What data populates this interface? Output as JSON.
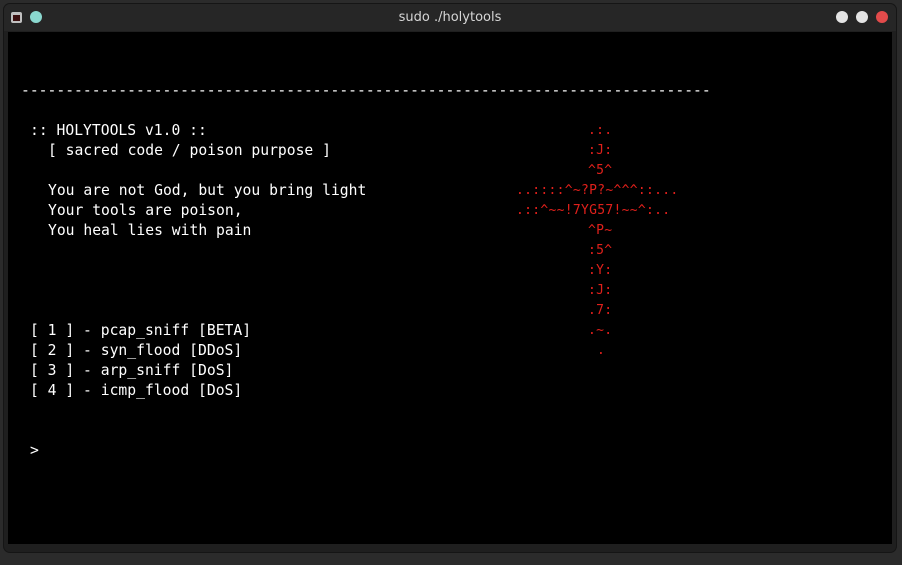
{
  "window": {
    "title": "sudo ./holytools"
  },
  "terminal": {
    "separator": "------------------------------------------------------------------------------",
    "header": ":: HOLYTOOLS v1.0 ::",
    "subheader": "[ sacred code / poison purpose ]",
    "verses": [
      "You are not God, but you bring light",
      "Your tools are poison,",
      "You heal lies with pain"
    ],
    "menu": [
      "[ 1 ] - pcap_sniff [BETA]",
      "[ 2 ] - syn_flood [DDoS]",
      "[ 3 ] - arp_sniff [DoS]",
      "[ 4 ] - icmp_flood [DoS]"
    ],
    "prompt": ">",
    "art_color": "#e0201b",
    "cross_art": [
      ".:.",
      ":J:",
      "^5^",
      "..::::^~?P?~^^^::...",
      ".::^~~!7YG57!~~^:..",
      "^P~",
      ":5^",
      ":Y:",
      ":J:",
      ".7:",
      ".~.",
      "."
    ]
  }
}
